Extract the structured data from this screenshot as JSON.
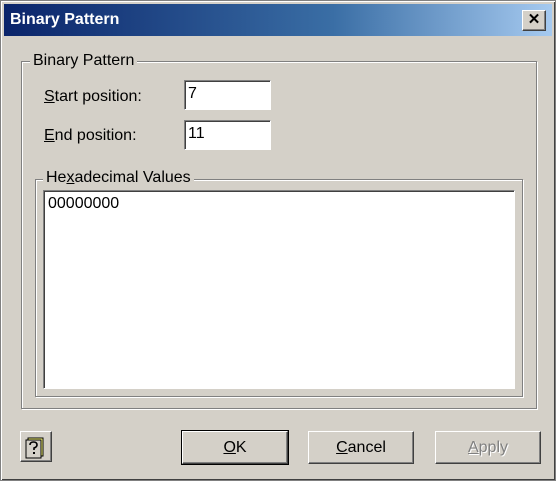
{
  "window": {
    "title": "Binary Pattern",
    "close_glyph": "✕"
  },
  "group_binary": {
    "label": "Binary Pattern"
  },
  "start": {
    "label_mnemonic": "S",
    "label_rest": "tart position:",
    "value": "7"
  },
  "end": {
    "label_mnemonic": "E",
    "label_rest": "nd position:",
    "value": "11"
  },
  "group_hex": {
    "label_pre": "He",
    "label_mnemonic": "x",
    "label_post": "adecimal Values",
    "content": "00000000"
  },
  "buttons": {
    "help_icon": "help-book-icon",
    "ok_mnemonic": "O",
    "ok_rest": "K",
    "cancel_mnemonic": "C",
    "cancel_rest": "ancel",
    "apply_mnemonic": "A",
    "apply_rest": "pply"
  }
}
